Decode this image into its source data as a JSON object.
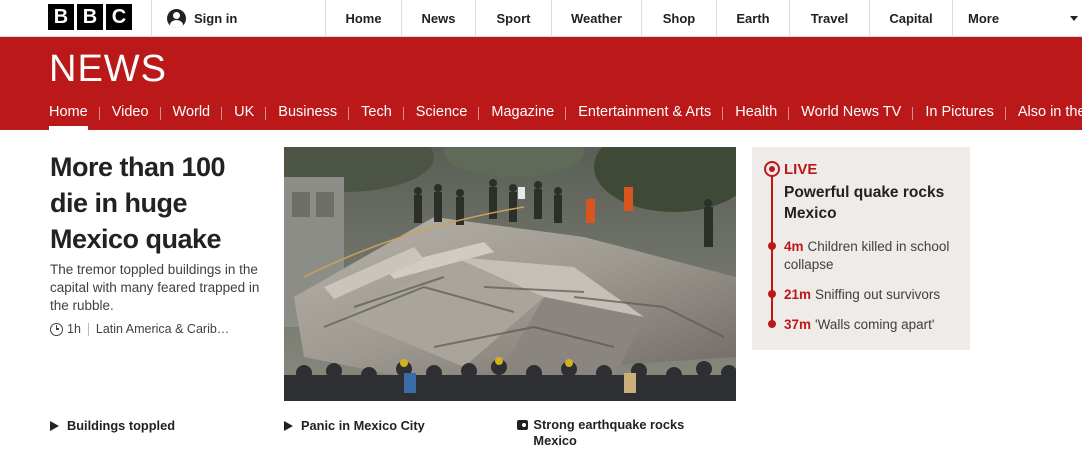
{
  "topbar": {
    "logo_letters": [
      "B",
      "B",
      "C"
    ],
    "signin_label": "Sign in",
    "nav": [
      {
        "label": "Home",
        "w": 76
      },
      {
        "label": "News",
        "w": 74
      },
      {
        "label": "Sport",
        "w": 76
      },
      {
        "label": "Weather",
        "w": 90
      },
      {
        "label": "Shop",
        "w": 75
      },
      {
        "label": "Earth",
        "w": 73
      },
      {
        "label": "Travel",
        "w": 80
      },
      {
        "label": "Capital",
        "w": 83
      }
    ],
    "more_label": "More"
  },
  "header": {
    "title": "NEWS",
    "subnav": [
      "Home",
      "Video",
      "World",
      "UK",
      "Business",
      "Tech",
      "Science",
      "Magazine",
      "Entertainment & Arts",
      "Health",
      "World News TV",
      "In Pictures",
      "Also in the N"
    ]
  },
  "main_story": {
    "headline": "More than 100 die in huge Mexico quake",
    "summary": "The tremor toppled buildings in the capital with many feared trapped in the rubble.",
    "time": "1h",
    "section": "Latin America & Carib…"
  },
  "live": {
    "label": "LIVE",
    "title": "Powerful quake rocks Mexico",
    "entries": [
      {
        "time": "4m",
        "text": "Children killed in school collapse"
      },
      {
        "time": "21m",
        "text": "Sniffing out survivors"
      },
      {
        "time": "37m",
        "text": "'Walls coming apart'"
      }
    ]
  },
  "related": {
    "buildings": "Buildings toppled",
    "panic": "Panic in Mexico City",
    "gallery": "Strong earthquake rocks Mexico"
  },
  "colors": {
    "brand_red": "#bb1919",
    "live_bg": "#eeebe8"
  }
}
